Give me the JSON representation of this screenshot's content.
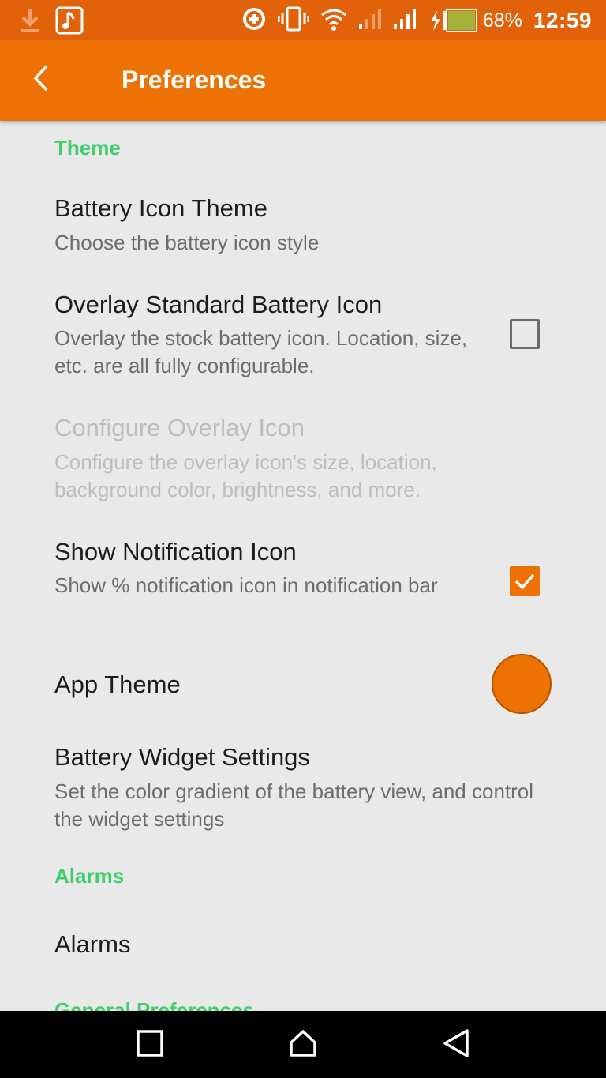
{
  "status_bar": {
    "battery_percent": "68%",
    "time": "12:59",
    "icons": [
      "download-icon",
      "music-note-icon",
      "data-saver-icon",
      "vibrate-icon",
      "wifi-icon",
      "signal-weak-icon",
      "signal-icon",
      "battery-charging-icon"
    ]
  },
  "app_bar": {
    "title": "Preferences",
    "back_icon": "chevron-left-icon",
    "color": "#ee7203"
  },
  "sections": {
    "theme": "Theme",
    "alarms": "Alarms",
    "general": "General Preferences"
  },
  "prefs": {
    "battery_icon_theme": {
      "title": "Battery Icon Theme",
      "summary": "Choose the battery icon style"
    },
    "overlay_standard": {
      "title": "Overlay Standard Battery Icon",
      "summary": "Overlay the stock battery icon. Location, size, etc. are all fully configurable.",
      "checked": false
    },
    "configure_overlay": {
      "title": "Configure Overlay Icon",
      "summary": "Configure the overlay icon's size, location, background color, brightness, and more.",
      "enabled": false
    },
    "show_notification": {
      "title": "Show Notification Icon",
      "summary": "Show % notification icon in notification bar",
      "checked": true
    },
    "app_theme": {
      "title": "App Theme",
      "color": "#ee7203"
    },
    "battery_widget": {
      "title": "Battery Widget Settings",
      "summary": "Set the color gradient of the battery view, and control the widget settings"
    },
    "alarms": {
      "title": "Alarms"
    }
  },
  "nav_bar": {
    "icons": [
      "recents-square-icon",
      "home-icon",
      "back-triangle-icon"
    ]
  },
  "colors": {
    "accent": "#ee7203",
    "section_header": "#3fce6b",
    "status_bar": "#e2620a"
  }
}
